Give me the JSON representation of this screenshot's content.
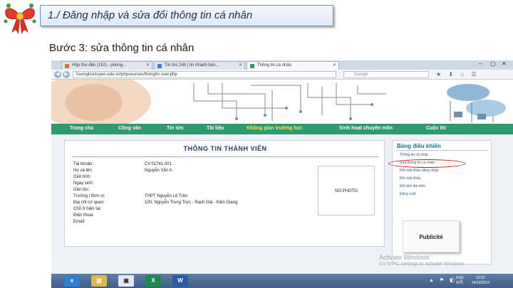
{
  "slide": {
    "title": "1./ Đăng nhập và sửa đổi thông tin cá nhân",
    "step": "Bước 3: sửa thông tin cá nhân"
  },
  "browser": {
    "tabs": [
      {
        "label": "Hộp thư đến (152) - phong..."
      },
      {
        "label": "Tin tức 24h | tin nhanh bon..."
      },
      {
        "label": "Thông tin cá nhân"
      }
    ],
    "url": "truongtructuyen.edu.vn/phpsources/thongtin user.php",
    "search_placeholder": "Google"
  },
  "site": {
    "nav": [
      "Trang chủ",
      "Công văn",
      "Tin tức",
      "Tài liệu",
      "Không gian trường học",
      "Sinh hoạt chuyên môn",
      "Cuộc thi"
    ],
    "panel_title": "THÔNG TIN THÀNH VIÊN",
    "fields": [
      {
        "label": "Tài khoản:",
        "value": "CV.01741.001"
      },
      {
        "label": "Họ và tên:",
        "value": "Nguyễn Văn A"
      },
      {
        "label": "Giới tính:",
        "value": ""
      },
      {
        "label": "Ngày sinh:",
        "value": ""
      },
      {
        "label": "Dân tộc:",
        "value": ""
      },
      {
        "label": "Trường / Đơn vị:",
        "value": "THPT Nguyễn Lê Trân"
      },
      {
        "label": "Địa chỉ cơ quan:",
        "value": "100, Nguyễn Trung Trực - Rạch Giá - Kiên Giang"
      },
      {
        "label": "Chỗ ở hiện tại:",
        "value": ""
      },
      {
        "label": "Điện thoại:",
        "value": ""
      },
      {
        "label": "Email:",
        "value": ""
      }
    ],
    "photo_text": "NO PHOTO",
    "control_panel": {
      "title": "Bảng điều khiển",
      "items": [
        "Thông tin cá nhân",
        "Sửa thông tin cá nhân",
        "Đổi mật khẩu đăng nhập",
        "Đổi mật khẩu",
        "Đổi ảnh đại diện",
        "Đăng xuất"
      ]
    },
    "publicite": "Publicité",
    "activate_title": "Activate Windows",
    "activate_sub": "Go to PC settings to activate Windows."
  },
  "taskbar": {
    "lang": "ENG\nINTL",
    "time": "15:51",
    "date": "24/10/2014"
  }
}
